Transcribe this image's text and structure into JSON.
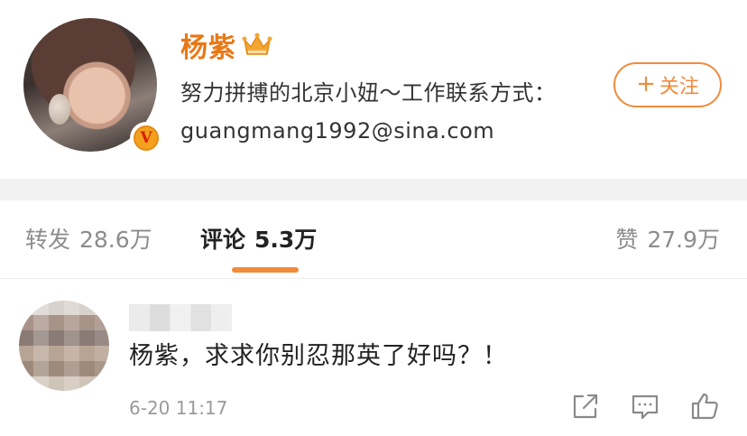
{
  "profile": {
    "name": "杨紫",
    "bio": "努力拼搏的北京小妞～工作联系方式：guangmang1992@sina.com",
    "follow_label": "关注",
    "follow_icon": "plus-icon",
    "verified_badge": "V",
    "badge_icon": "crown-icon"
  },
  "tabs": [
    {
      "label": "转发",
      "count": "28.6万",
      "active": false
    },
    {
      "label": "评论",
      "count": "5.3万",
      "active": true
    },
    {
      "label": "赞",
      "count": "27.9万",
      "active": false
    }
  ],
  "comment": {
    "username": "",
    "text": "杨紫，求求你别忍那英了好吗？！",
    "time": "6-20 11:17",
    "actions": [
      "share-icon",
      "reply-icon",
      "like-icon"
    ]
  },
  "colors": {
    "accent_orange": "#f08b3c",
    "name_orange": "#ea7816",
    "text_dark": "#222222",
    "text_muted": "#8c8c8c"
  }
}
